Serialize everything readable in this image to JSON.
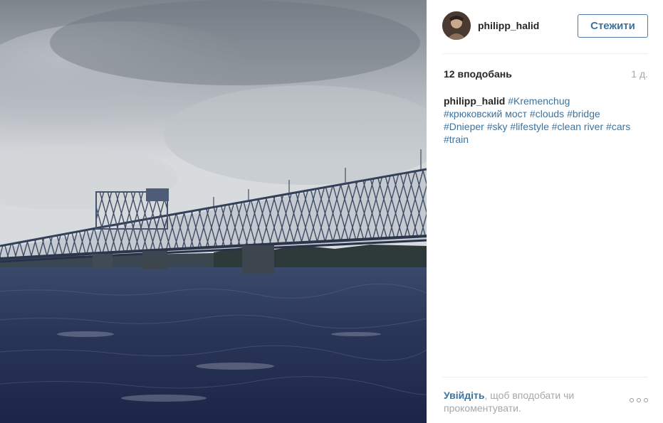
{
  "post": {
    "photo_alt": "",
    "author": {
      "username": "philipp_halid",
      "avatar_icon": "user-avatar-photo"
    },
    "follow_label": "Стежити",
    "likes": "12 вподобань",
    "time_ago": "1 д.",
    "caption": {
      "username": "philipp_halid",
      "hashtags": [
        "#Kremenchug",
        "#крюковский  мост",
        "#clouds",
        "#bridge",
        "#Dnieper",
        "#sky",
        "#lifestyle",
        "#clean  river",
        "#cars",
        "#train"
      ]
    },
    "footer": {
      "login_link": "Увійдіть",
      "login_rest": ", щоб вподобати чи прокоментувати.",
      "more_icon": "more-options-icon"
    }
  },
  "colors": {
    "link_blue": "#3f729b",
    "muted_gray": "#a5a7aa",
    "follow_border": "#4d7aa8"
  }
}
